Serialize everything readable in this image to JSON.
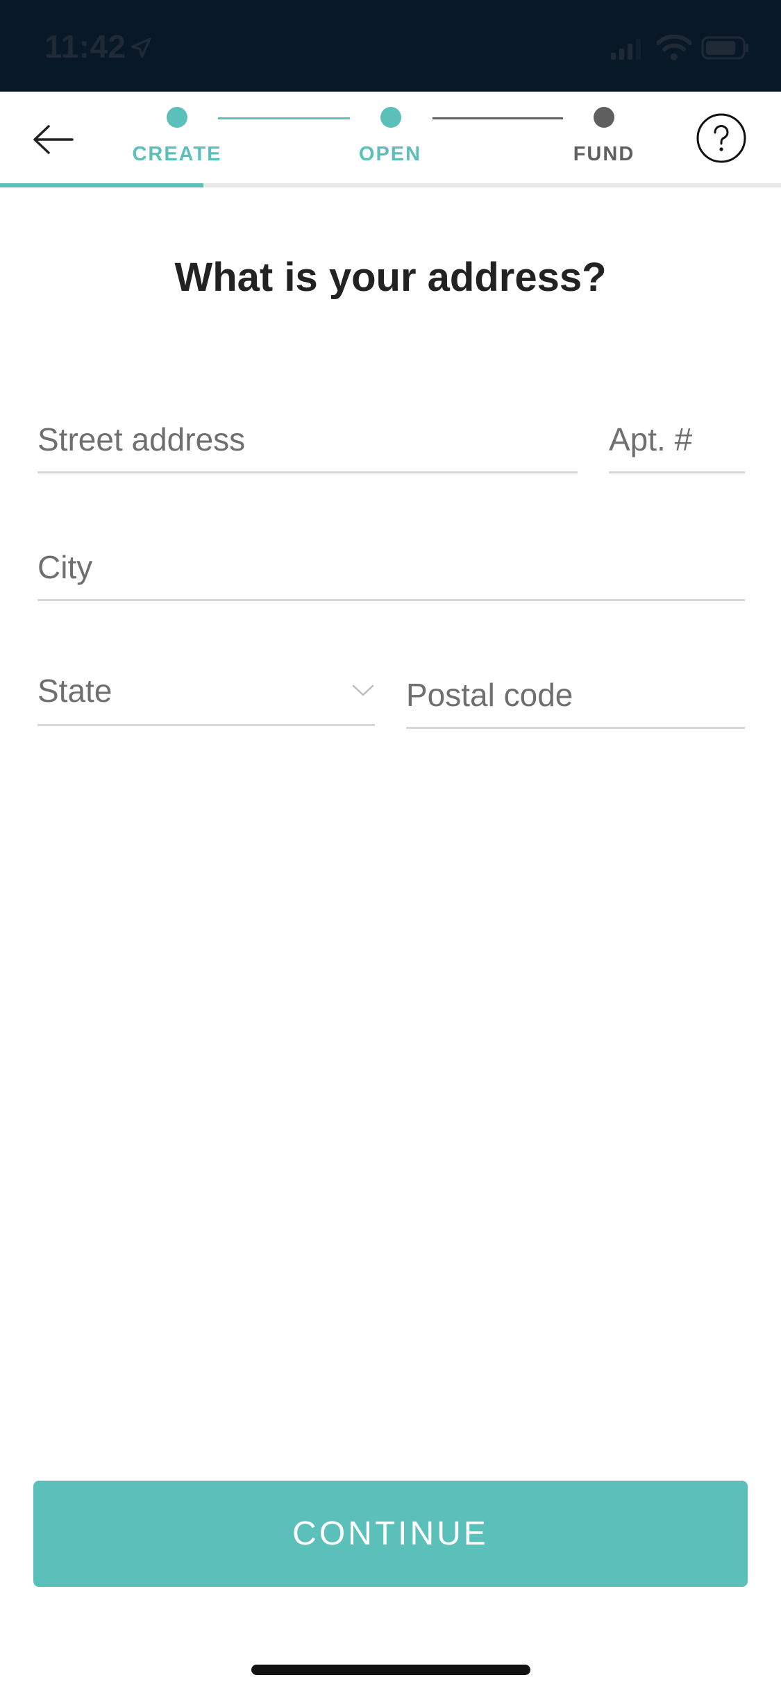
{
  "status_bar": {
    "time": "11:42"
  },
  "header": {
    "steps": [
      {
        "label": "CREATE",
        "state": "complete",
        "color": "#5bc0b9"
      },
      {
        "label": "OPEN",
        "state": "active",
        "color": "#5bc0b9"
      },
      {
        "label": "FUND",
        "state": "upcoming",
        "color": "#5f5f5f"
      }
    ],
    "progress_fraction": 0.26
  },
  "page": {
    "title": "What is your address?"
  },
  "form": {
    "street_placeholder": "Street address",
    "apt_placeholder": "Apt. #",
    "city_placeholder": "City",
    "state_label": "State",
    "postal_placeholder": "Postal code"
  },
  "footer": {
    "continue_label": "CONTINUE"
  },
  "colors": {
    "accent": "#5bc0b9",
    "status_bar_bg": "#091827",
    "heading": "#222222"
  }
}
